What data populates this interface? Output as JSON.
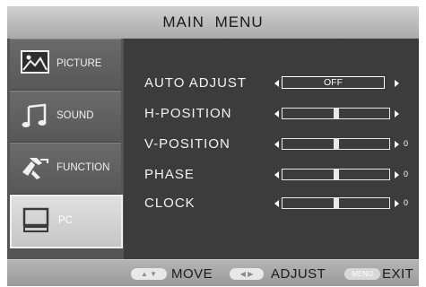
{
  "header": {
    "title": "MAIN  MENU"
  },
  "sidebar": {
    "items": [
      {
        "label": "PICTURE",
        "icon": "picture-icon"
      },
      {
        "label": "SOUND",
        "icon": "music-note-icon"
      },
      {
        "label": "FUNCTION",
        "icon": "tools-icon"
      },
      {
        "label": "PC",
        "icon": "monitor-icon",
        "active": true
      }
    ]
  },
  "settings": [
    {
      "name": "AUTO ADJUST",
      "type": "option",
      "value": "OFF"
    },
    {
      "name": "H-POSITION",
      "type": "slider",
      "level": 0.5
    },
    {
      "name": "V-POSITION",
      "type": "slider",
      "level": 0.5,
      "value": "0"
    },
    {
      "name": "PHASE",
      "type": "slider",
      "level": 0.5,
      "value": "0"
    },
    {
      "name": "CLOCK",
      "type": "slider",
      "level": 0.5,
      "value": "0"
    }
  ],
  "footer": {
    "move_label": "MOVE",
    "adjust_label": "ADJUST",
    "menu_key": "MENU",
    "exit_label": "EXIT"
  },
  "colors": {
    "panel": "#3c3c3c",
    "header": "#bdbdbd",
    "active_tab": "#d4d4d4"
  }
}
